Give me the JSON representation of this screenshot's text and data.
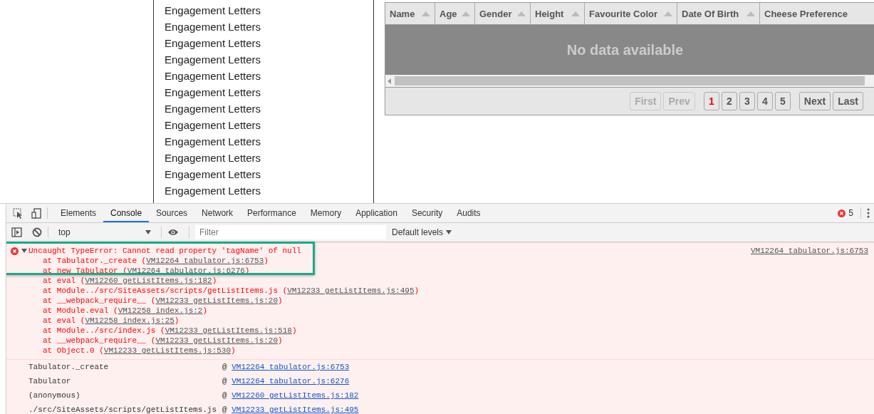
{
  "list": {
    "items": [
      "Engagement Letters",
      "Engagement Letters",
      "Engagement Letters",
      "Engagement Letters",
      "Engagement Letters",
      "Engagement Letters",
      "Engagement Letters",
      "Engagement Letters",
      "Engagement Letters",
      "Engagement Letters",
      "Engagement Letters",
      "Engagement Letters"
    ]
  },
  "table": {
    "columns": [
      {
        "label": "Name"
      },
      {
        "label": "Age"
      },
      {
        "label": "Gender"
      },
      {
        "label": "Height"
      },
      {
        "label": "Favourite Color"
      },
      {
        "label": "Date Of Birth"
      },
      {
        "label": "Cheese Preference"
      }
    ],
    "empty_message": "No data available",
    "pagination": [
      {
        "label": "First",
        "kind": "nav",
        "disabled": true,
        "selected": false
      },
      {
        "label": "Prev",
        "kind": "nav",
        "disabled": true,
        "selected": false
      },
      {
        "label": "1",
        "kind": "page",
        "disabled": false,
        "selected": true
      },
      {
        "label": "2",
        "kind": "page",
        "disabled": false,
        "selected": false
      },
      {
        "label": "3",
        "kind": "page",
        "disabled": false,
        "selected": false
      },
      {
        "label": "4",
        "kind": "page",
        "disabled": false,
        "selected": false
      },
      {
        "label": "5",
        "kind": "page",
        "disabled": false,
        "selected": false
      },
      {
        "label": "Next",
        "kind": "nav",
        "disabled": false,
        "selected": false
      },
      {
        "label": "Last",
        "kind": "nav",
        "disabled": false,
        "selected": false
      }
    ]
  },
  "devtools": {
    "tabs": [
      {
        "label": "Elements",
        "selected": false
      },
      {
        "label": "Console",
        "selected": true
      },
      {
        "label": "Sources",
        "selected": false
      },
      {
        "label": "Network",
        "selected": false
      },
      {
        "label": "Performance",
        "selected": false
      },
      {
        "label": "Memory",
        "selected": false
      },
      {
        "label": "Application",
        "selected": false
      },
      {
        "label": "Security",
        "selected": false
      },
      {
        "label": "Audits",
        "selected": false
      }
    ],
    "error_count": "5",
    "context": "top",
    "filter": {
      "placeholder": "Filter"
    },
    "levels": "Default levels",
    "error": {
      "message": "Uncaught TypeError: Cannot read property 'tagName' of null",
      "expanded": true,
      "source": "VM12264 tabulator.js:6753",
      "stack": [
        {
          "text": "at Tabulator._create (",
          "link": "VM12264 tabulator.js:6753",
          "end": ")"
        },
        {
          "text": "at new Tabulator (",
          "link": "VM12264 tabulator.js:6276",
          "end": ")"
        },
        {
          "text": "at eval (",
          "link": "VM12260 getListItems.js:182",
          "end": ")"
        },
        {
          "text": "at Module../src/SiteAssets/scripts/getListItems.js (",
          "link": "VM12233 getListItems.js:495",
          "end": ")"
        },
        {
          "text": "at __webpack_require__ (",
          "link": "VM12233 getListItems.js:20",
          "end": ")"
        },
        {
          "text": "at Module.eval (",
          "link": "VM12258 index.js:2",
          "end": ")"
        },
        {
          "text": "at eval (",
          "link": "VM12258 index.js:25",
          "end": ")"
        },
        {
          "text": "at Module../src/index.js (",
          "link": "VM12233 getListItems.js:518",
          "end": ")"
        },
        {
          "text": "at __webpack_require__ (",
          "link": "VM12233 getListItems.js:20",
          "end": ")"
        },
        {
          "text": "at Object.0 (",
          "link": "VM12233 getListItems.js:530",
          "end": ")"
        }
      ]
    },
    "call_stack": [
      {
        "function": "Tabulator._create",
        "at": "@",
        "link": "VM12264 tabulator.js:6753"
      },
      {
        "function": "Tabulator",
        "at": "@",
        "link": "VM12264 tabulator.js:6276"
      },
      {
        "function": "(anonymous)",
        "at": "@",
        "link": "VM12260 getListItems.js:182"
      },
      {
        "function": "./src/SiteAssets/scripts/getListItems.js",
        "at": "@",
        "link": "VM12233 getListItems.js:495"
      }
    ]
  }
}
